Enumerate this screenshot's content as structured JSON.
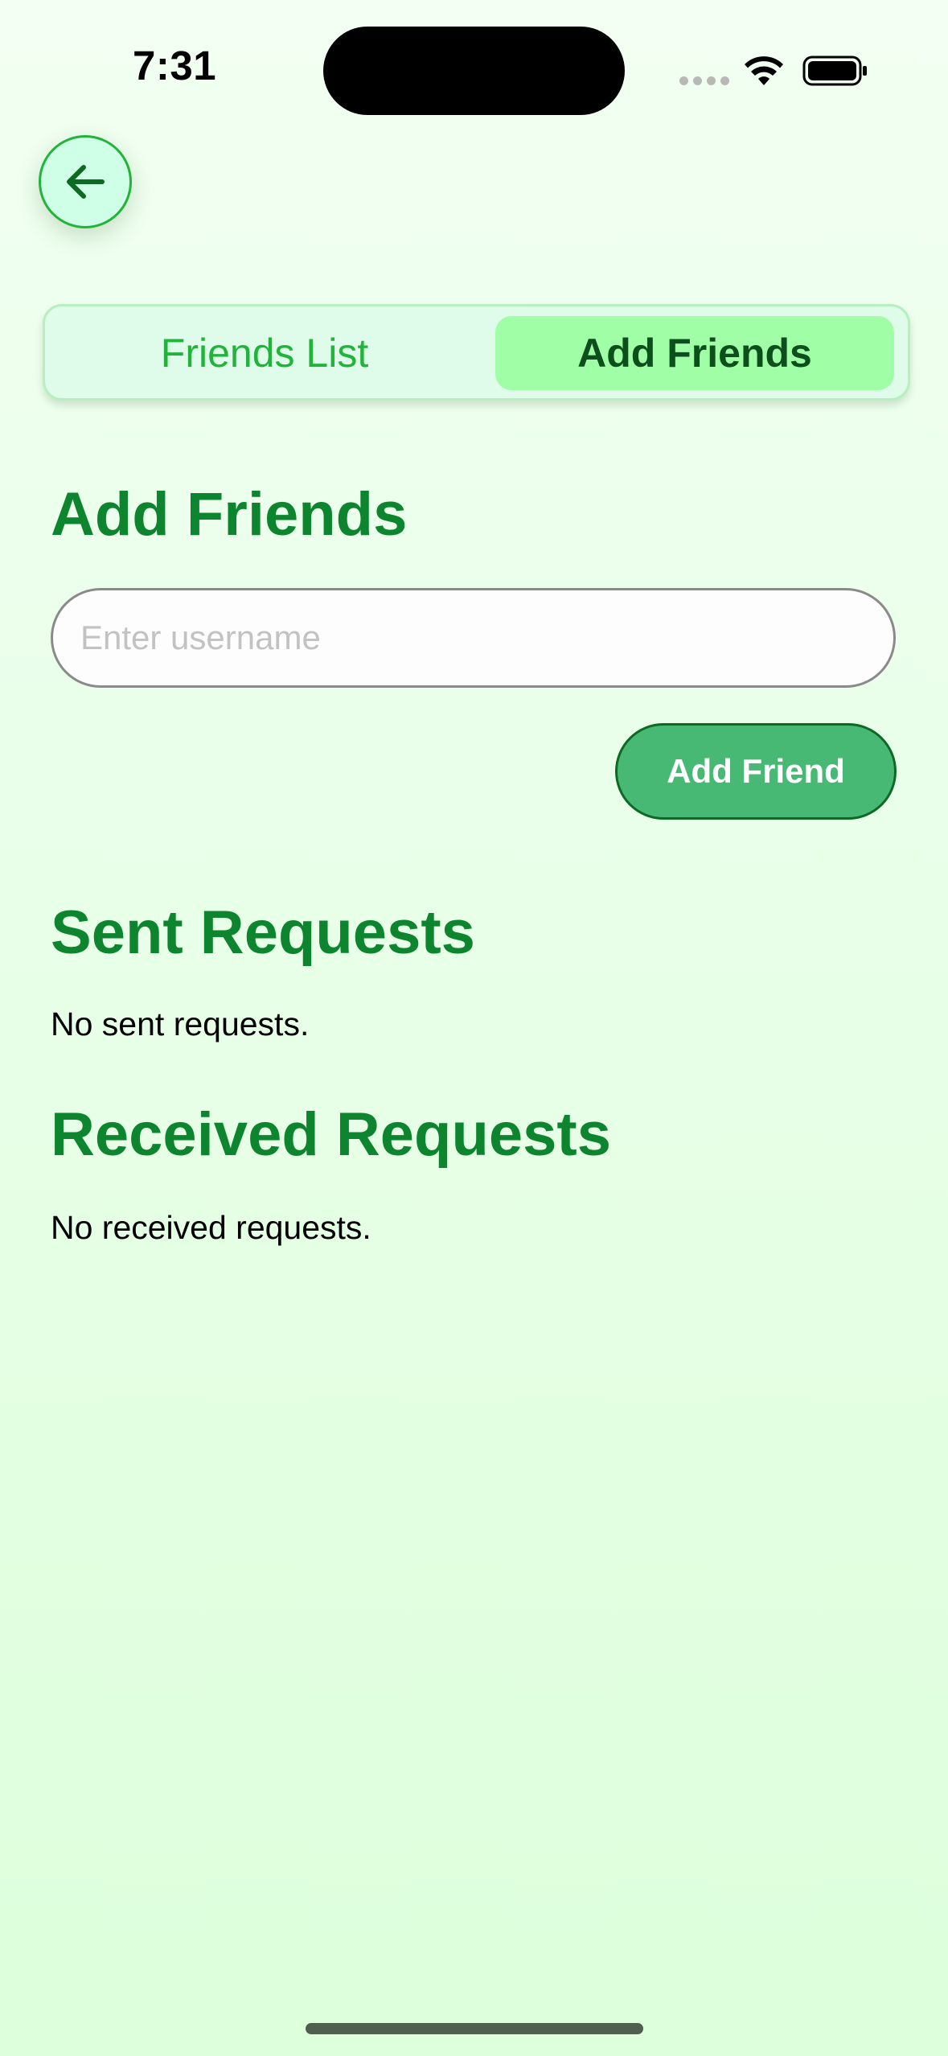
{
  "status_bar": {
    "time": "7:31"
  },
  "back_button": {
    "icon": "arrow-left-icon"
  },
  "tabs": [
    {
      "label": "Friends List",
      "selected": false
    },
    {
      "label": "Add Friends",
      "selected": true
    }
  ],
  "add_friends": {
    "title": "Add Friends",
    "input_placeholder": "Enter username",
    "input_value": "",
    "button_label": "Add Friend"
  },
  "sent_requests": {
    "title": "Sent Requests",
    "empty_text": "No sent requests."
  },
  "received_requests": {
    "title": "Received Requests",
    "empty_text": "No received requests."
  },
  "colors": {
    "accent": "#0d852f",
    "button_fill": "#48b975",
    "tab_selected": "#a0ffa6",
    "tab_unselected_text": "#22b33a"
  }
}
